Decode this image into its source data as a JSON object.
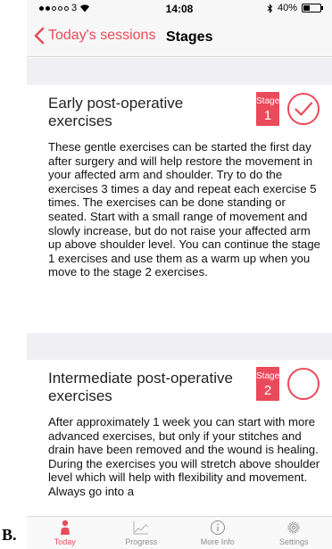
{
  "figure_label": "B.",
  "status_bar": {
    "carrier": "3",
    "time": "14:08",
    "battery": "40%",
    "battery_level": 0.4
  },
  "nav": {
    "back_label": "Today's sessions",
    "title": "Stages"
  },
  "sessions": [
    {
      "title": "Early post-operative exercises",
      "stage_word": "Stage",
      "stage_number": "1",
      "completed": true,
      "description": "These gentle exercises can be started the first day after surgery and will help restore the movement in your affected arm and shoulder. Try to do the exercises 3 times a day and repeat each exercise 5 times. The exercises can be done standing or seated. Start with a small range of movement and slowly increase, but do not raise your affected arm up above shoulder level. You can continue the stage 1 exercises and use them as a warm up when you move to the stage 2 exercises."
    },
    {
      "title": "Intermediate post-operative exercises",
      "stage_word": "Stage",
      "stage_number": "2",
      "completed": false,
      "description": "After approximately 1 week you can start with more advanced exercises, but only if your stitches and drain have been removed and the wound is healing. During the exercises you will stretch above shoulder level which will help with flexibility and movement. Always go into a"
    }
  ],
  "tabs": [
    {
      "label": "Today",
      "icon": "person-icon",
      "active": true
    },
    {
      "label": "Progress",
      "icon": "chart-icon",
      "active": false
    },
    {
      "label": "More Info",
      "icon": "info-icon",
      "active": false
    },
    {
      "label": "Settings",
      "icon": "gear-icon",
      "active": false
    }
  ],
  "colors": {
    "accent": "#ea4a5a",
    "band": "#efeff4",
    "inactive": "#8e8e93"
  }
}
